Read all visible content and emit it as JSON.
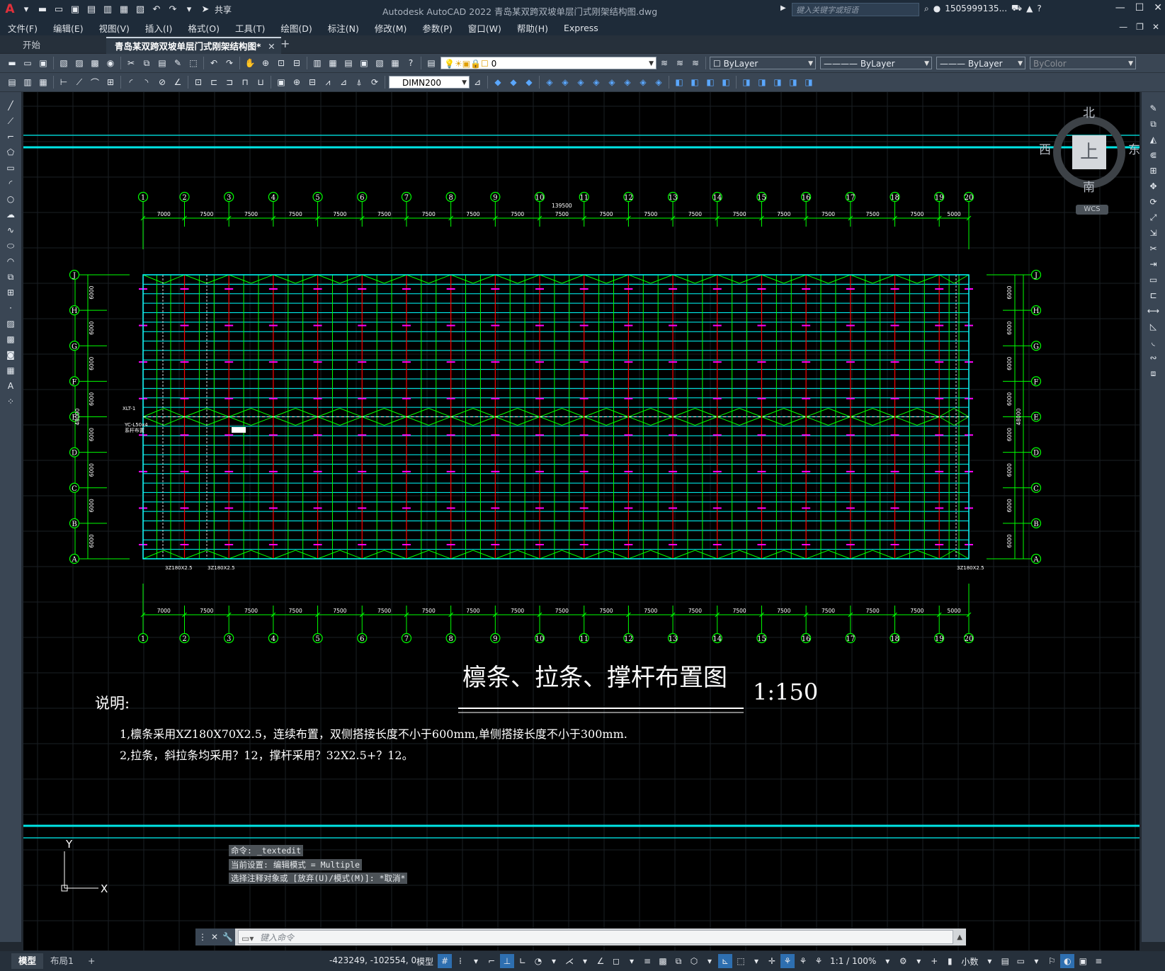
{
  "titlebar": {
    "app_logo": "A",
    "share_label": "共享",
    "title": "Autodesk AutoCAD 2022    青岛某双跨双坡单层门式刚架结构图.dwg",
    "search_placeholder": "键入关键字或短语",
    "user": "1505999135...",
    "icons": [
      "new-icon",
      "open-icon",
      "save-icon",
      "saveas-icon",
      "plot-icon",
      "undo-icon",
      "redo-icon",
      "share-icon",
      "search-icon",
      "user-icon",
      "cart-icon",
      "autodesk-icon",
      "help-icon"
    ]
  },
  "menubar": {
    "items": [
      "文件(F)",
      "编辑(E)",
      "视图(V)",
      "插入(I)",
      "格式(O)",
      "工具(T)",
      "绘图(D)",
      "标注(N)",
      "修改(M)",
      "参数(P)",
      "窗口(W)",
      "帮助(H)",
      "Express"
    ]
  },
  "tabs": {
    "start": "开始",
    "active": "青岛某双跨双坡单层门式刚架结构图*",
    "close": "✕",
    "plus": "+"
  },
  "toolbar1": {
    "layer": "0",
    "color": "ByLayer",
    "linetype": "ByLayer",
    "lineweight": "ByLayer",
    "plotstyle": "ByColor"
  },
  "toolbar2": {
    "dimstyle": "DIMN200"
  },
  "viewcube": {
    "north": "北",
    "south": "南",
    "east": "东",
    "west": "西",
    "face": "上",
    "wcs": "WCS"
  },
  "drawing": {
    "colors": {
      "grid": "#00ff00",
      "cyan": "#00ffff",
      "red": "#ff0000",
      "magenta": "#ff00ff",
      "white": "#ffffff"
    },
    "axes_numbers": [
      "1",
      "2",
      "3",
      "4",
      "5",
      "6",
      "7",
      "8",
      "9",
      "10",
      "11",
      "12",
      "13",
      "14",
      "15",
      "16",
      "17",
      "18",
      "19",
      "20"
    ],
    "axes_letters": [
      "J",
      "H",
      "G",
      "F",
      "E",
      "D",
      "C",
      "B",
      "A"
    ],
    "top_spacings": [
      "7000",
      "7500",
      "7500",
      "7500",
      "7500",
      "7500",
      "7500",
      "7500",
      "7500",
      "7500",
      "7500",
      "7500",
      "7500",
      "7500",
      "7500",
      "7500",
      "7500",
      "7500",
      "5000"
    ],
    "bottom_spacings": [
      "7000",
      "7500",
      "7500",
      "7500",
      "7500",
      "7500",
      "7500",
      "7500",
      "7500",
      "7500",
      "7500",
      "7500",
      "7500",
      "7500",
      "7500",
      "7500",
      "7500",
      "7500",
      "5000"
    ],
    "total_length": "139500",
    "side_spacings": [
      "6000",
      "6000",
      "6000",
      "6000",
      "6000",
      "6000",
      "6000",
      "6000"
    ],
    "total_width": "48000",
    "left_notes": [
      "XLT-1",
      "YC-L50x4",
      "系杆布置"
    ],
    "bottom_notes": [
      "3Z180X2.5",
      "3Z180X2.5",
      "3Z180X2.5"
    ],
    "title": "檩条、拉条、撑杆布置图",
    "scale": "1:150",
    "notes_heading": "说明:",
    "note1": "1,檩条采用XZ180X70X2.5，连续布置，双侧搭接长度不小于600mm,单侧搭接长度不小于300mm.",
    "note2": "2,拉条，斜拉条均采用？12，撑杆采用？32X2.5+？12。"
  },
  "command": {
    "history": [
      "命令: _textedit",
      "当前设置: 编辑模式 = Multiple",
      "选择注释对象或 [放弃(U)/模式(M)]: *取消*"
    ],
    "placeholder": "键入命令",
    "ucs_x": "X",
    "ucs_y": "Y"
  },
  "statusbar": {
    "tabs": [
      "模型",
      "布局1"
    ],
    "plus": "+",
    "coords": "-423249, -102554, 0",
    "model": "模型",
    "scale": "1:1 / 100%",
    "units": "小数"
  }
}
